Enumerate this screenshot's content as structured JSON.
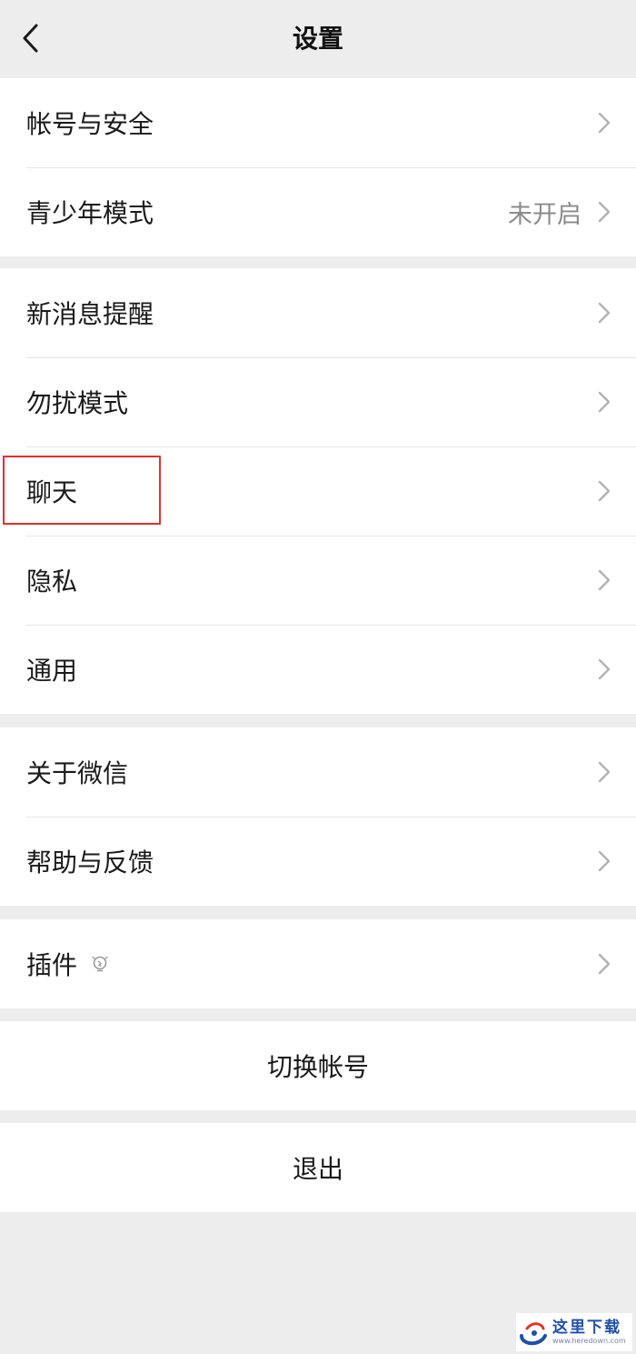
{
  "nav": {
    "title": "设置"
  },
  "group1": [
    {
      "label": "帐号与安全"
    },
    {
      "label": "青少年模式",
      "value": "未开启"
    }
  ],
  "group2": [
    {
      "label": "新消息提醒"
    },
    {
      "label": "勿扰模式"
    },
    {
      "label": "聊天"
    },
    {
      "label": "隐私"
    },
    {
      "label": "通用"
    }
  ],
  "group3": [
    {
      "label": "关于微信"
    },
    {
      "label": "帮助与反馈"
    }
  ],
  "group4": [
    {
      "label": "插件",
      "icon": "lightbulb-icon"
    }
  ],
  "actions": {
    "switch_account": "切换帐号",
    "logout": "退出"
  },
  "watermark": {
    "main": "这里下载",
    "sub": "www.heredown.com"
  },
  "colors": {
    "background": "#ededed",
    "highlight": "#e0312e"
  }
}
